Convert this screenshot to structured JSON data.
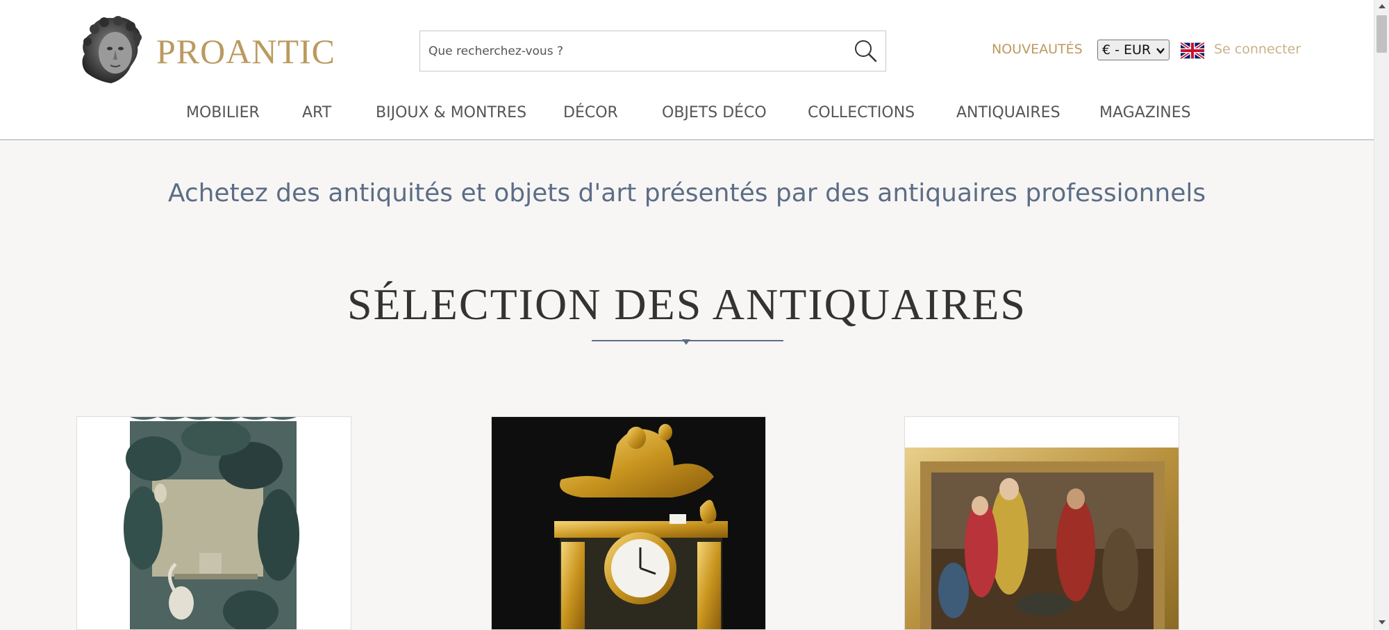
{
  "header": {
    "brand": "PROANTIC",
    "search": {
      "placeholder": "Que recherchez-vous ?"
    },
    "nouveautes": "NOUVEAUTÉS",
    "currency": "€ - EUR",
    "login": "Se connecter"
  },
  "nav": {
    "items": [
      {
        "label": "MOBILIER"
      },
      {
        "label": "ART"
      },
      {
        "label": "BIJOUX & MONTRES"
      },
      {
        "label": "DÉCOR"
      },
      {
        "label": "OBJETS DÉCO"
      },
      {
        "label": "COLLECTIONS"
      },
      {
        "label": "ANTIQUAIRES"
      },
      {
        "label": "MAGAZINES"
      }
    ]
  },
  "main": {
    "tagline": "Achetez des antiquités et objets d'art présentés par des antiquaires professionnels",
    "section_title": "SÉLECTION DES ANTIQUAIRES"
  },
  "colors": {
    "gold": "#bb9a5e",
    "slate": "#5c6d86",
    "page_bg": "#f7f6f5"
  }
}
